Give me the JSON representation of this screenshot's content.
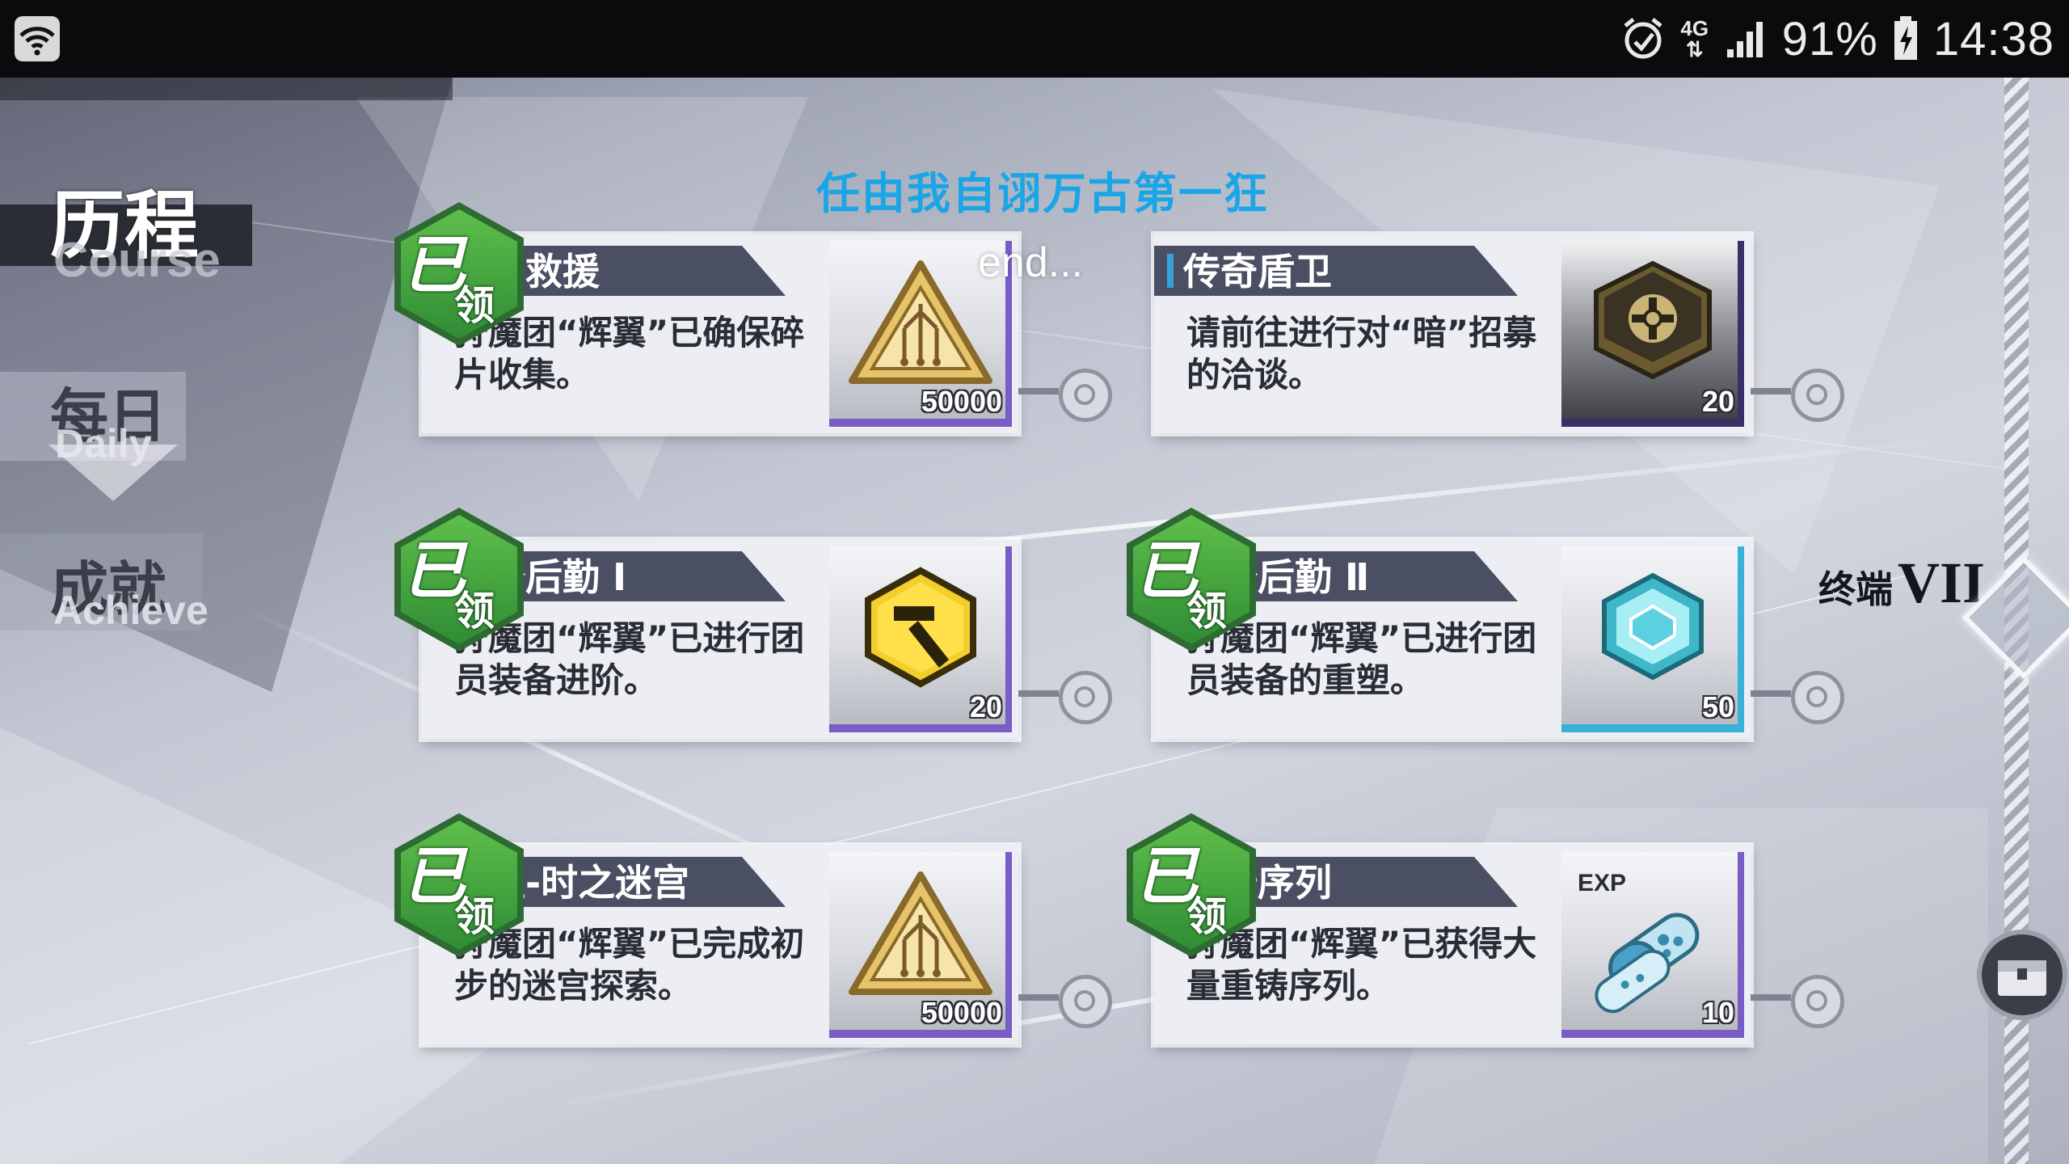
{
  "status_bar": {
    "network": "4G",
    "battery": "91%",
    "time": "14:38"
  },
  "nav": {
    "course": {
      "cn": "历程",
      "en": "Course"
    },
    "daily": {
      "cn": "每日",
      "en": "Daily"
    },
    "achieve": {
      "cn": "成就",
      "en": "Achieve"
    }
  },
  "page": {
    "title": "任由我自诩万古第一狂",
    "end_label": "end...",
    "terminal_label": "终端",
    "terminal_roman": "VII"
  },
  "badge": {
    "char1": "已",
    "char2": "领"
  },
  "cards": [
    {
      "title": "碎片救援",
      "desc": "狩魔团“辉翼”已确保碎片收集。",
      "reward_qty": "50000",
      "reward_icon": "triangle-emblem-icon",
      "claimed": true
    },
    {
      "title": "传奇盾卫",
      "desc": "请前往进行对“暗”招募的洽谈。",
      "reward_qty": "20",
      "reward_icon": "dark-hex-token-icon",
      "claimed": false
    },
    {
      "title": "装备后勤 Ⅰ",
      "desc": "狩魔团“辉翼”已进行团员装备进阶。",
      "reward_qty": "20",
      "reward_icon": "gold-hex-hammer-icon",
      "claimed": true
    },
    {
      "title": "装备后勤 Ⅱ",
      "desc": "狩魔团“辉翼”已进行团员装备的重塑。",
      "reward_qty": "50",
      "reward_icon": "cyan-hex-gem-icon",
      "claimed": true
    },
    {
      "title": "远征-时之迷宫",
      "desc": "狩魔团“辉翼”已完成初步的迷宫探索。",
      "reward_qty": "50000",
      "reward_icon": "triangle-emblem-icon",
      "claimed": true
    },
    {
      "title": "重铸序列",
      "desc": "狩魔团“辉翼”已获得大量重铸序列。",
      "reward_qty": "10",
      "reward_icon": "exp-capsule-icon",
      "claimed": true,
      "reward_caption": "EXP"
    }
  ],
  "colors": {
    "title_blue": "#1aa6e6",
    "badge_green": "#3fa140",
    "rarity_purple": "#7a5cc7",
    "rarity_cyan": "#3ab2d8"
  }
}
